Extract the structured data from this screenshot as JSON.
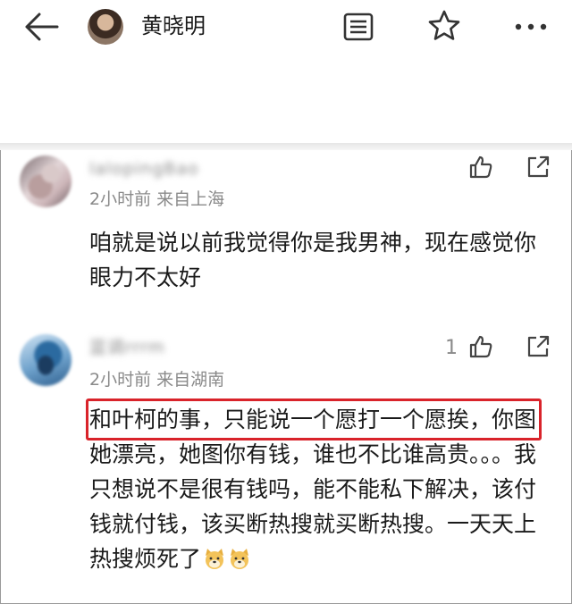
{
  "header": {
    "user_name": "黄晓明"
  },
  "comments": [
    {
      "username": "lalopingBao",
      "time": "2小时前",
      "location": "来自上海",
      "meta": "2小时前  来自上海",
      "text": "咱就是说以前我觉得你是我男神，现在感觉你眼力不太好",
      "likes": ""
    },
    {
      "username": "蓝调rrrm",
      "time": "2小时前",
      "location": "来自湖南",
      "meta": "2小时前  来自湖南",
      "text_highlight": "和叶柯的事，只能说一个愿打一个愿挨，",
      "text_rest": "你图她漂亮，她图你有钱，谁也不比谁高贵。。。我只想说不是很有钱吗，能不能私下解决，该付钱就付钱，该买断热搜就买断热搜。一天天上热搜烦死了",
      "likes": "1"
    }
  ],
  "colors": {
    "highlight_border": "#d9232a",
    "meta_text": "#8a8a8a",
    "icon_stroke": "#333333"
  },
  "icons": [
    "back-arrow-icon",
    "avatar",
    "document-icon",
    "star-icon",
    "more-icon",
    "like-icon",
    "share-icon",
    "doge-emoji-icon"
  ]
}
